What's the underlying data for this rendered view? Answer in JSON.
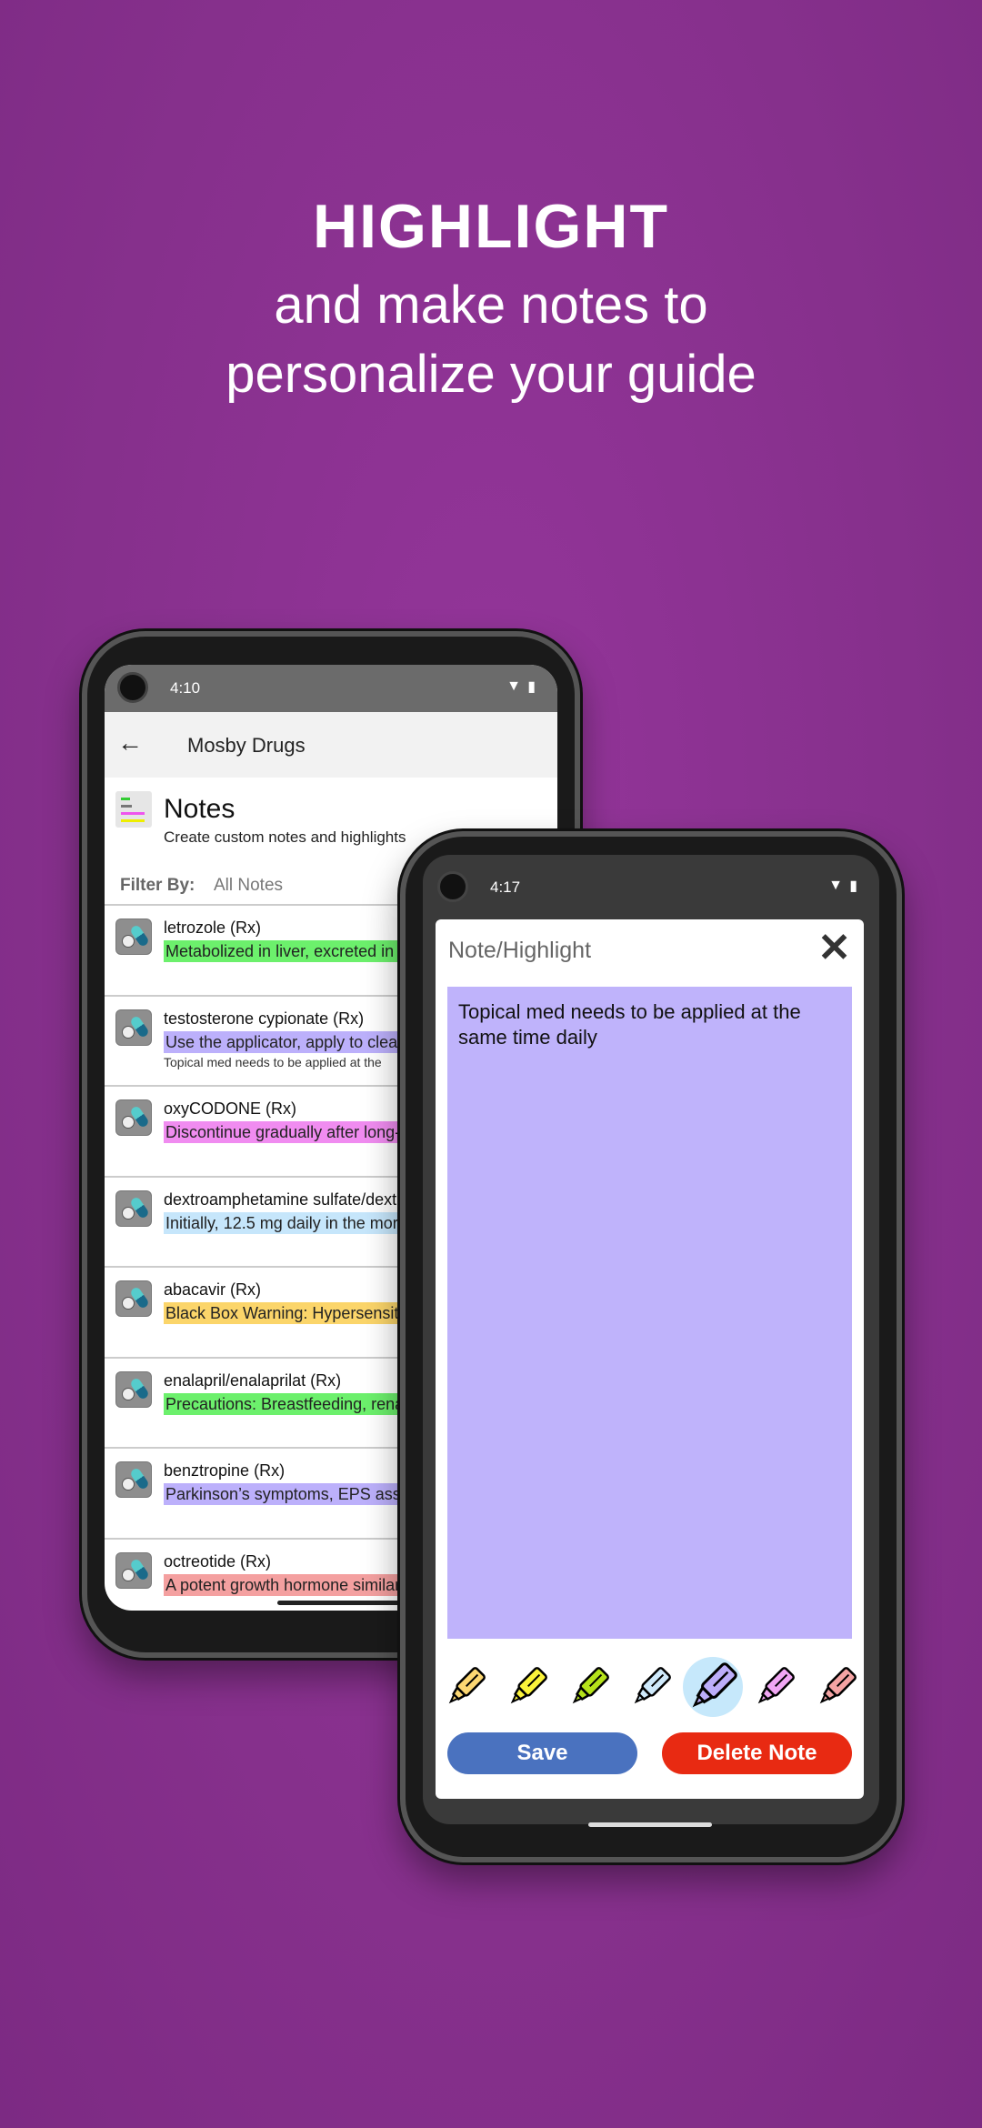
{
  "hero": {
    "title": "HIGHLIGHT",
    "subtitle_line1": "and make notes to",
    "subtitle_line2": "personalize your guide"
  },
  "phone1": {
    "status_time": "4:10",
    "toolbar": {
      "title": "Mosby Drugs",
      "back_icon": "arrow-left-icon"
    },
    "header": {
      "title": "Notes",
      "subtitle": "Create custom notes and highlights"
    },
    "filter": {
      "label": "Filter By:",
      "value": "All Notes"
    },
    "notes": [
      {
        "name": "letrozole (Rx)",
        "highlight": "Metabolized in liver, excreted in u",
        "color": "#6cf06c"
      },
      {
        "name": "testosterone cypionate (Rx)",
        "highlight": "Use the applicator, apply to clean",
        "color": "#bcb0fb",
        "note": "Topical med needs to be applied at the"
      },
      {
        "name": "oxyCODONE (Rx)",
        "highlight": "Discontinue gradually after long-",
        "color": "#f08cf0"
      },
      {
        "name": "dextroamphetamine sulfate/dext",
        "highlight": "Initially, 12.5 mg daily in the morn",
        "color": "#c6e6fb"
      },
      {
        "name": "abacavir (Rx)",
        "highlight": "Black Box Warning: Hypersensitiv",
        "color": "#fbd56a"
      },
      {
        "name": "enalapril/enalaprilat (Rx)",
        "highlight": "Precautions: Breastfeeding, rena",
        "color": "#6cf06c"
      },
      {
        "name": "benztropine (Rx)",
        "highlight": "Parkinson’s symptoms, EPS asso",
        "color": "#bcb0fb"
      },
      {
        "name": "octreotide (Rx)",
        "highlight": "A potent growth hormone similar",
        "color": "#f4a0a0"
      }
    ]
  },
  "phone2": {
    "status_time": "4:17",
    "dialog": {
      "title": "Note/Highlight",
      "close_icon": "close-icon",
      "note_text": "Topical med needs to be applied at the same time daily",
      "note_color": "#bfb3fb",
      "markers": [
        {
          "color": "#fcd772"
        },
        {
          "color": "#fbf33a"
        },
        {
          "color": "#b5e21a"
        },
        {
          "color": "#cfeafc"
        },
        {
          "color": "#bcadf9",
          "selected": true
        },
        {
          "color": "#f1a6f4"
        },
        {
          "color": "#f4a3a3"
        }
      ],
      "save_label": "Save",
      "delete_label": "Delete Note",
      "save_color": "#4a72bf",
      "delete_color": "#e82a12"
    }
  }
}
